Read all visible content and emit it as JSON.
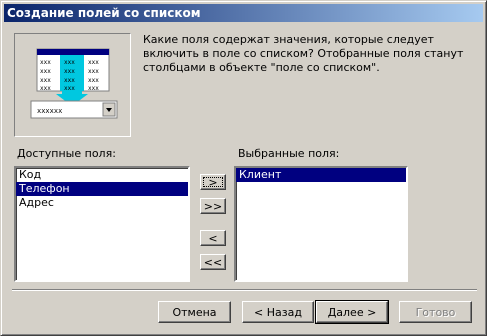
{
  "window": {
    "title": "Создание полей со списком"
  },
  "prompt": {
    "text": "Какие поля содержат значения, которые следует включить в поле со списком? Отобранные поля станут столбцами в объекте \"поле со списком\"."
  },
  "illustration": {
    "combo_value": "xxxxxx",
    "cell_text": "xxx"
  },
  "available": {
    "label": "Доступные поля:",
    "items": [
      "Код",
      "Телефон",
      "Адрес"
    ],
    "selected_index": 1
  },
  "selected": {
    "label": "Выбранные поля:",
    "items": [
      "Клиент"
    ],
    "selected_index": 0
  },
  "move_buttons": {
    "add_one": ">",
    "add_all": ">>",
    "remove_one": "<",
    "remove_all": "<<"
  },
  "footer": {
    "cancel": "Отмена",
    "back": "< Назад",
    "next": "Далее >",
    "finish": "Готово"
  },
  "colors": {
    "title_start": "#0a246a",
    "title_end": "#a6caf0",
    "selection": "#000080",
    "face": "#d4d0c8",
    "cyan": "#00c8e0"
  }
}
